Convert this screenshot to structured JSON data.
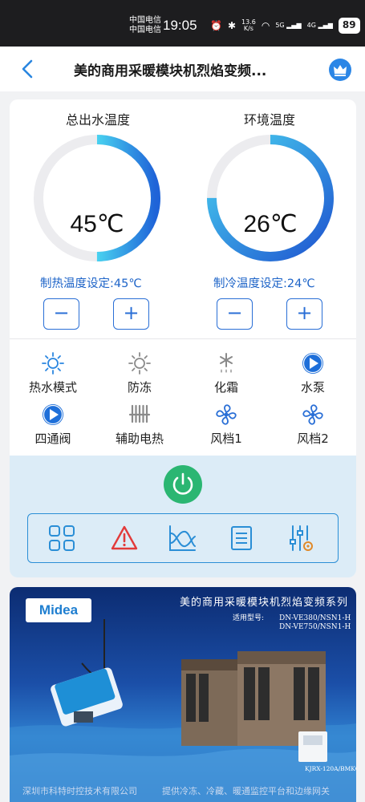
{
  "status_bar": {
    "carrier_1": "中国电信",
    "carrier_2": "中国电信",
    "time": "19:05",
    "net_speed_top": "13.6",
    "net_speed_bottom": "K/s",
    "signal_1": "5G",
    "signal_2": "4G",
    "battery": "89"
  },
  "header": {
    "title": "美的商用采暖模块机烈焰变频...",
    "back_icon": "chevron-left-icon",
    "vip_icon": "crown-icon"
  },
  "gauges": [
    {
      "title": "总出水温度",
      "value": "45℃",
      "level": 0.5,
      "setpoint": "制热温度设定:45℃",
      "minus": "−",
      "plus": "+"
    },
    {
      "title": "环境温度",
      "value": "26℃",
      "level": 0.75,
      "setpoint": "制冷温度设定:24℃",
      "minus": "−",
      "plus": "+"
    }
  ],
  "functions": [
    {
      "label": "热水模式",
      "icon": "sun-icon"
    },
    {
      "label": "防冻",
      "icon": "sun-icon"
    },
    {
      "label": "化霜",
      "icon": "snowflake-drop-icon"
    },
    {
      "label": "水泵",
      "icon": "play-icon"
    },
    {
      "label": "四通阀",
      "icon": "play-icon"
    },
    {
      "label": "辅助电热",
      "icon": "heater-icon"
    },
    {
      "label": "风档1",
      "icon": "fan-icon"
    },
    {
      "label": "风档2",
      "icon": "fan-icon"
    }
  ],
  "toolbar": {
    "power_icon": "power-icon",
    "items": [
      "grid-icon",
      "warning-icon",
      "chart-icon",
      "document-icon",
      "settings-sliders-icon"
    ]
  },
  "banner": {
    "logo": "Midea",
    "title": "美的商用采暖模块机烈焰变频系列",
    "model_label": "适用型号:",
    "model_1": "DN-VE380/NSN1-H",
    "model_2": "DN-VE750/NSN1-H",
    "controller": "KJRX-120A/BMKO",
    "footer_left": "深圳市科特时控技术有限公司",
    "footer_right": "提供冷冻、冷藏、暖通监控平台和边缘网关"
  },
  "colors": {
    "accent": "#2a6fd6",
    "gauge_gradient_start": "#1f63d8",
    "gauge_gradient_end": "#49d2f0",
    "power": "#2bb672",
    "warning": "#e23a3a"
  }
}
